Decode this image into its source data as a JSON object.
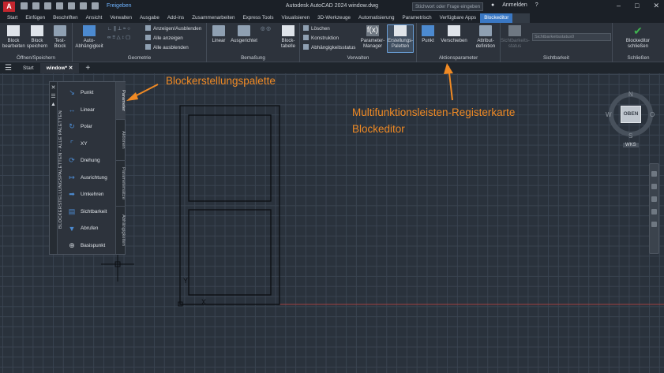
{
  "app": {
    "logo": "A",
    "title": "Autodesk AutoCAD 2024    window.dwg",
    "share": "Freigeben",
    "search_placeholder": "Stichwort oder Frage eingeben",
    "user": "Anmelden"
  },
  "tabs": [
    "Start",
    "Einfügen",
    "Beschriften",
    "Ansicht",
    "Verwalten",
    "Ausgabe",
    "Add-ins",
    "Zusammenarbeiten",
    "Express Tools",
    "Visualisieren",
    "3D-Werkzeuge",
    "Automatisierung",
    "Parametrisch",
    "Verfügbare Apps",
    "Blockeditor"
  ],
  "ribbon": {
    "group1": {
      "label": "Öffnen/Speichern",
      "b1": "Block bearbeiten",
      "b2": "Block speichern",
      "b3": "Test-Block"
    },
    "group2": {
      "label": "Geometrie",
      "b1": "Auto-Abhängigkeit",
      "s1": "Anzeigen/Ausblenden",
      "s2": "Alle anzeigen",
      "s3": "Alle ausblenden"
    },
    "group3": {
      "label": "Bemaßung",
      "b1": "Linear",
      "b2": "Ausgerichtet",
      "b3": "Block-tabelle"
    },
    "group4": {
      "label": "Verwalten",
      "s1": "Löschen",
      "s2": "Konstruktion",
      "s3": "Abhängigkeitsstatus",
      "b1": "Parameter-Manager",
      "b2": "Erstellungs-Paletten"
    },
    "group5": {
      "label": "Aktionsparameter",
      "b1": "Punkt",
      "b2": "Verschieben",
      "b3": "Attribut-definition"
    },
    "group6": {
      "label": "Sichtbarkeit",
      "b1": "Sichtbarkeits-status",
      "dropdown": "Sichtbarkeitsstatus0"
    },
    "group7": {
      "label": "Schließen",
      "b1": "Blockeditor schließen"
    }
  },
  "doctabs": {
    "start": "Start",
    "file": "window*",
    "add": "+"
  },
  "palette": {
    "title": "BLOCKERSTELLUNGSPALETTEN - ALLE PALETTEN",
    "items": [
      "Punkt",
      "Linear",
      "Polar",
      "XY",
      "Drehung",
      "Ausrichtung",
      "Umkehren",
      "Sichtbarkeit",
      "Abrufen",
      "Basispunkt"
    ],
    "vtabs": [
      "Parameter",
      "Aktionen",
      "Parametersätze",
      "Abhängigkeiten"
    ]
  },
  "annotations": {
    "palette": "Blockerstellungspalette",
    "ribbon_line1": "Multifunktionsleisten-Registerkarte",
    "ribbon_line2": "Blockeditor"
  },
  "viewcube": {
    "face": "OBEN",
    "n": "N",
    "s": "S",
    "w": "W",
    "o": "O",
    "wks": "WKS"
  },
  "ucs": {
    "y": "Y",
    "x": "X"
  },
  "colors": {
    "annotation": "#f08a24",
    "active_tab": "#3a78c4",
    "title_logo": "#c4262e"
  }
}
